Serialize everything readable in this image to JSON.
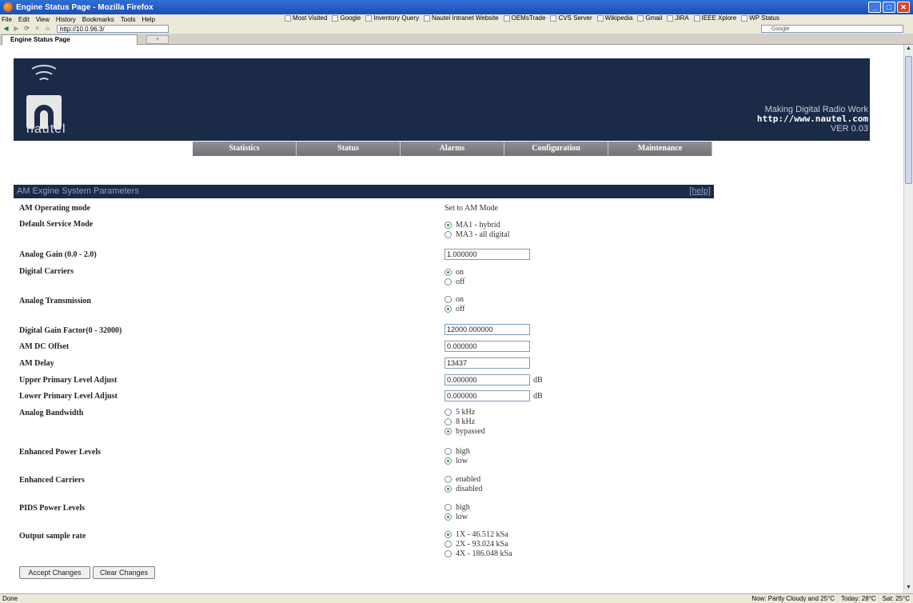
{
  "window": {
    "title": "Engine Status Page - Mozilla Firefox"
  },
  "menubar": {
    "menus": [
      "File",
      "Edit",
      "View",
      "History",
      "Bookmarks",
      "Tools",
      "Help"
    ],
    "bookmarks": [
      "Most Visited",
      "Google",
      "Inventory Query",
      "Nautel Intranet Website",
      "OEMsTrade",
      "CVS Server",
      "Wikipedia",
      "Gmail",
      "JIRA",
      "IEEE Xplore",
      "WP Status"
    ]
  },
  "navbar": {
    "url": "http://10.0.96.3/",
    "search_engine": "Google"
  },
  "tab": {
    "title": "Engine Status Page"
  },
  "header": {
    "brand": "nautel",
    "tagline": "Making Digital Radio Work",
    "website": "http://www.nautel.com",
    "version": "VER 0.03",
    "brand_color": "#1b2a47"
  },
  "nav": [
    "Statistics",
    "Status",
    "Alarms",
    "Configuration",
    "Maintenance"
  ],
  "section": {
    "title": "AM Exgine System Parameters",
    "help": "[help]"
  },
  "params": {
    "op_mode": {
      "label": "AM Operating mode",
      "value": "Set to AM Mode"
    },
    "service_mode": {
      "label": "Default Service Mode",
      "options": [
        "MA1 - hybrid",
        "MA3 - all digital"
      ],
      "selected": 0
    },
    "analog_gain": {
      "label": "Analog Gain (0.0 - 2.0)",
      "value": "1.000000"
    },
    "digital_carriers": {
      "label": "Digital Carriers",
      "options": [
        "on",
        "off"
      ],
      "selected": 0
    },
    "analog_tx": {
      "label": "Analog Transmission",
      "options": [
        "on",
        "off"
      ],
      "selected": 1
    },
    "digital_gain": {
      "label": "Digital Gain Factor(0 - 32000)",
      "value": "12000.000000"
    },
    "dc_offset": {
      "label": "AM DC Offset",
      "value": "0.000000"
    },
    "am_delay": {
      "label": "AM Delay",
      "value": "13437"
    },
    "upper_level": {
      "label": "Upper Primary Level Adjust",
      "value": "0.000000",
      "unit": "dB"
    },
    "lower_level": {
      "label": "Lower Primary Level Adjust",
      "value": "0.000000",
      "unit": "dB"
    },
    "analog_bw": {
      "label": "Analog Bandwidth",
      "options": [
        "5 kHz",
        "8 kHz",
        "bypassed"
      ],
      "selected": 2
    },
    "enh_power": {
      "label": "Enhanced Power Levels",
      "options": [
        "high",
        "low"
      ],
      "selected": 1
    },
    "enh_carriers": {
      "label": "Enhanced Carriers",
      "options": [
        "enabled",
        "disabled"
      ],
      "selected": 1
    },
    "pids_power": {
      "label": "PIDS Power Levels",
      "options": [
        "high",
        "low"
      ],
      "selected": 1
    },
    "sample_rate": {
      "label": "Output sample rate",
      "options": [
        "1X - 46.512 kSa",
        "2X - 93.024 kSa",
        "4X - 186.048 kSa"
      ],
      "selected": 0
    }
  },
  "buttons": {
    "accept": "Accept Changes",
    "clear": "Clear Changes"
  },
  "statusbar": {
    "status": "Done",
    "weather": "Now: Partly Cloudy and 25°C",
    "today": "Today: 28°C",
    "sat": "Sat: 25°C"
  }
}
